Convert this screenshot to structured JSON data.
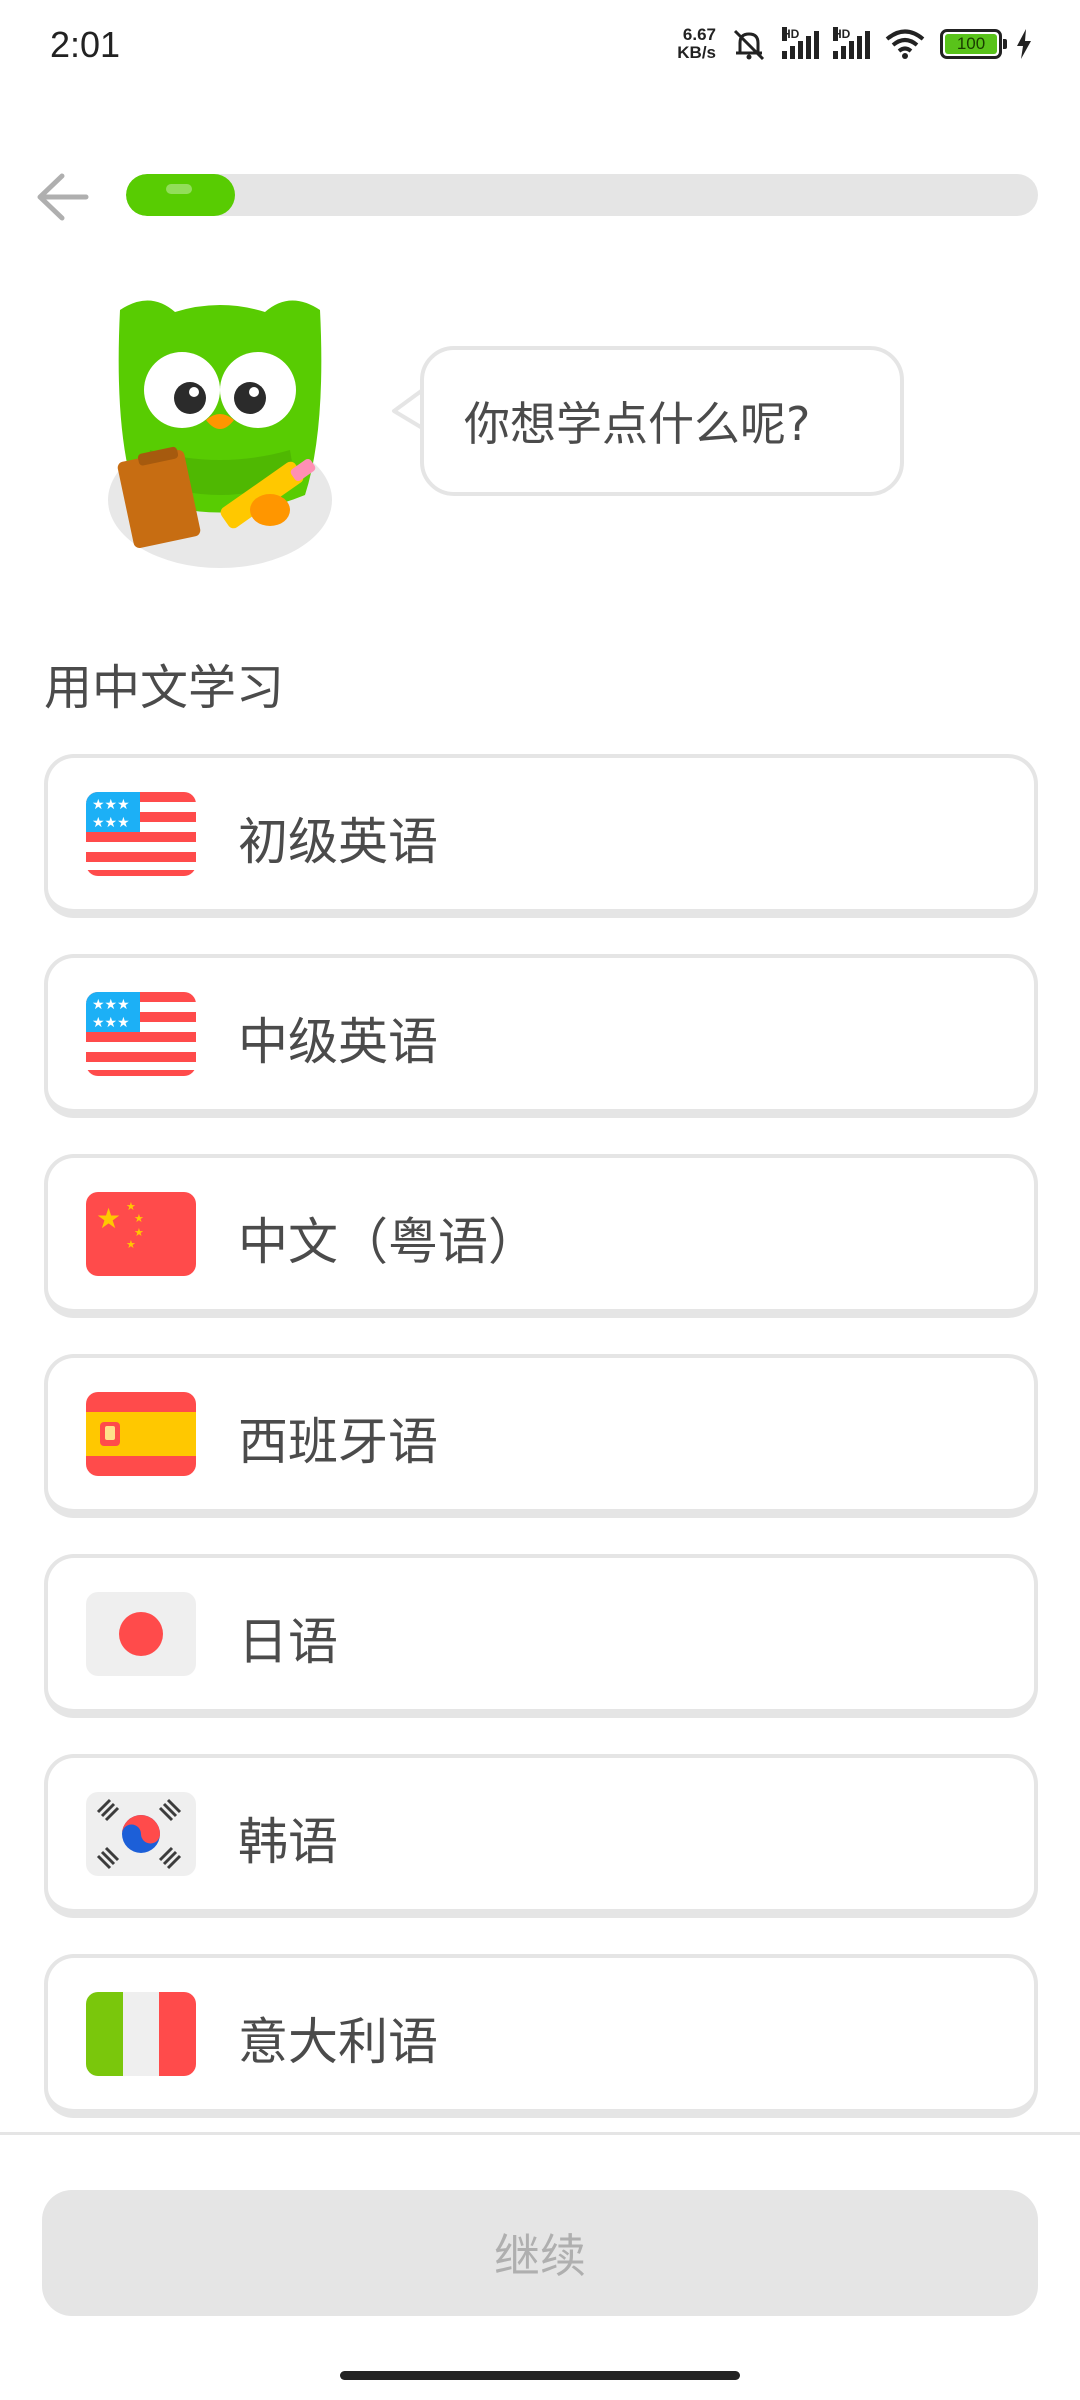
{
  "status_bar": {
    "time": "2:01",
    "net_speed_value": "6.67",
    "net_speed_unit": "KB/s",
    "hd_label_1": "HD",
    "hd_label_2": "HD",
    "battery": "100"
  },
  "header": {
    "back_icon": "arrow-left-icon",
    "progress_fraction": 0.12
  },
  "mascot": {
    "speech": "你想学点什么呢?"
  },
  "section": {
    "title": "用中文学习"
  },
  "courses": [
    {
      "label": "初级英语",
      "flag": "us-flag-icon"
    },
    {
      "label": "中级英语",
      "flag": "us-flag-icon"
    },
    {
      "label": "中文（粤语）",
      "flag": "china-flag-icon"
    },
    {
      "label": "西班牙语",
      "flag": "spain-flag-icon"
    },
    {
      "label": "日语",
      "flag": "japan-flag-icon"
    },
    {
      "label": "韩语",
      "flag": "korea-flag-icon"
    },
    {
      "label": "意大利语",
      "flag": "italy-flag-icon"
    }
  ],
  "footer": {
    "continue_label": "继续"
  },
  "colors": {
    "accent_green": "#58cc02",
    "border_gray": "#e5e5e5",
    "disabled_text": "#afafaf"
  }
}
